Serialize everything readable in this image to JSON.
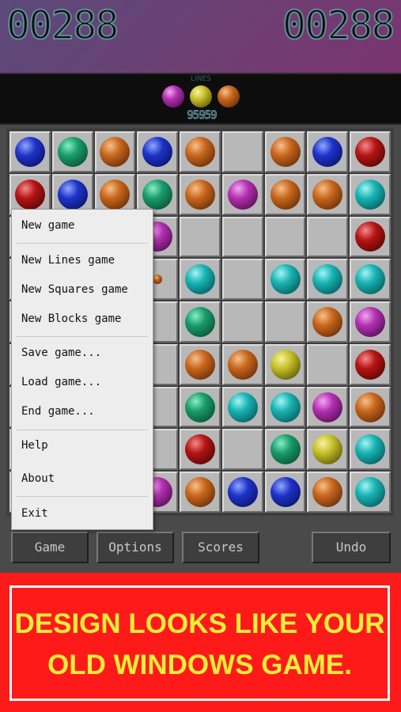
{
  "score": {
    "left": "00288",
    "right": "00288",
    "label": "LINES",
    "best": "95959"
  },
  "next_balls": [
    "purple",
    "yellow",
    "orange"
  ],
  "board": [
    [
      "blue",
      "green",
      "orange",
      "blue",
      "orange",
      "",
      "orange",
      "blue",
      "red"
    ],
    [
      "red",
      "blue",
      "orange",
      "green",
      "orange",
      "purple",
      "orange",
      "orange",
      "teal"
    ],
    [
      "",
      "",
      "",
      "purple",
      "",
      "",
      "",
      "",
      "red"
    ],
    [
      "",
      "",
      "",
      "small-orange",
      "teal",
      "",
      "teal",
      "teal",
      "teal"
    ],
    [
      "",
      "",
      "",
      "",
      "green",
      "",
      "",
      "orange",
      "purple"
    ],
    [
      "",
      "",
      "",
      "",
      "orange",
      "orange",
      "yellow",
      "",
      "red"
    ],
    [
      "",
      "",
      "",
      "",
      "green",
      "teal",
      "teal",
      "purple",
      "orange"
    ],
    [
      "",
      "",
      "",
      "",
      "red",
      "",
      "green",
      "yellow",
      "teal"
    ],
    [
      "",
      "",
      "",
      "purple",
      "orange",
      "blue",
      "blue",
      "orange",
      "teal"
    ]
  ],
  "menu": {
    "items": [
      "New game",
      "New Lines game",
      "New Squares game",
      "New Blocks game",
      "Save game...",
      "Load game...",
      "End game...",
      "Help",
      "About",
      "Exit"
    ]
  },
  "toolbar": {
    "game": "Game",
    "options": "Options",
    "scores": "Scores",
    "undo": "Undo"
  },
  "promo": {
    "line1": "DESIGN LOOKS LIKE YOUR",
    "line2": "OLD WINDOWS GAME."
  }
}
